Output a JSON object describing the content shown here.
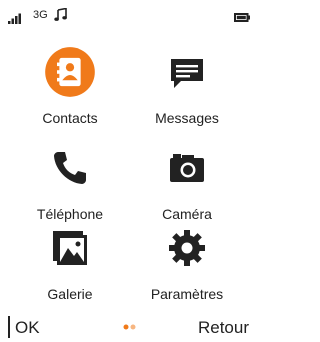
{
  "status_bar": {
    "network": "3G",
    "signal_icon": "signal-bars-icon",
    "media_icon": "music-note-icon",
    "battery_icon": "battery-icon"
  },
  "apps": [
    {
      "label": "Contacts",
      "icon": "contacts-book-icon",
      "selected": true
    },
    {
      "label": "Messages",
      "icon": "message-bubble-icon",
      "selected": false
    },
    {
      "label": "Téléphone",
      "icon": "phone-handset-icon",
      "selected": false
    },
    {
      "label": "Caméra",
      "icon": "camera-icon",
      "selected": false
    },
    {
      "label": "Galerie",
      "icon": "image-gallery-icon",
      "selected": false
    },
    {
      "label": "Paramètres",
      "icon": "gear-icon",
      "selected": false
    }
  ],
  "softkeys": {
    "left": "OK",
    "right": "Retour"
  },
  "colors": {
    "accent": "#f07a1a",
    "icon": "#222222",
    "text": "#222222"
  }
}
